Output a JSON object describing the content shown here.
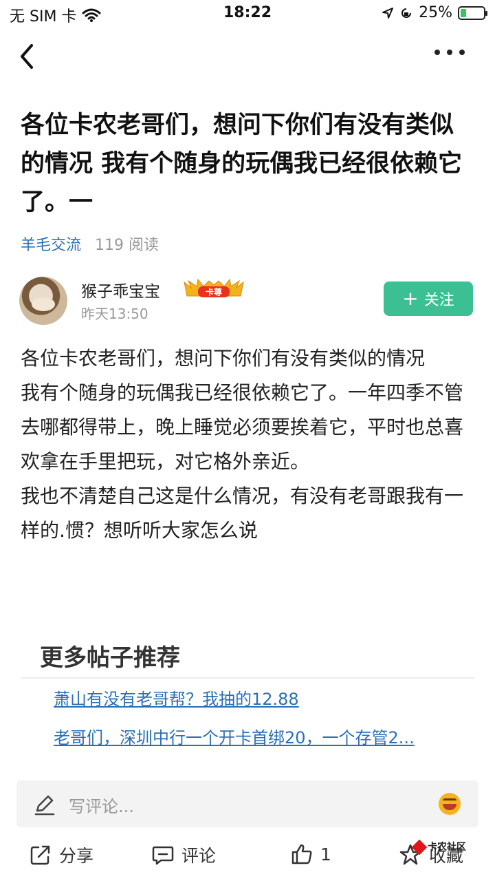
{
  "status_bar": {
    "carrier": "无 SIM 卡",
    "time": "18:22",
    "battery": "25%",
    "battery_level": 0.25
  },
  "post": {
    "title": "各位卡农老哥们，想问下你们有没有类似的情况 我有个随身的玩偶我已经很依赖它了。一",
    "category": "羊毛交流",
    "reads": "119 阅读",
    "author": {
      "name": "猴子乖宝宝",
      "badge": "卡尊",
      "time": "昨天13:50"
    },
    "follow_label": "关注",
    "body": [
      "各位卡农老哥们，想问下你们有没有类似的情况",
      "我有个随身的玩偶我已经很依赖它了。一年四季不管去哪都得带上，晚上睡觉必须要挨着它，平时也总喜欢拿在手里把玩，对它格外亲近。",
      "我也不清楚自己这是什么情况，有没有老哥跟我有一样的.惯？想听听大家怎么说"
    ]
  },
  "recommend": {
    "title": "更多帖子推荐",
    "items": [
      "萧山有没有老哥帮？我抽的12.88",
      "老哥们，深圳中行一个开卡首绑20，一个存管2..."
    ]
  },
  "comment": {
    "placeholder": "写评论..."
  },
  "bottom_bar": {
    "share": "分享",
    "comment": "评论",
    "likes": "1",
    "favorite": "收藏",
    "watermark": "卡农社区"
  },
  "colors": {
    "accent": "#3cbf93",
    "link": "#2a6fb6",
    "muted": "#999999"
  },
  "icons": [
    "wifi-icon",
    "location-icon",
    "lock-rotation-icon",
    "battery-icon",
    "back-icon",
    "more-icon",
    "pencil-icon",
    "emoji-icon",
    "share-icon",
    "comment-icon",
    "like-icon",
    "star-icon"
  ]
}
